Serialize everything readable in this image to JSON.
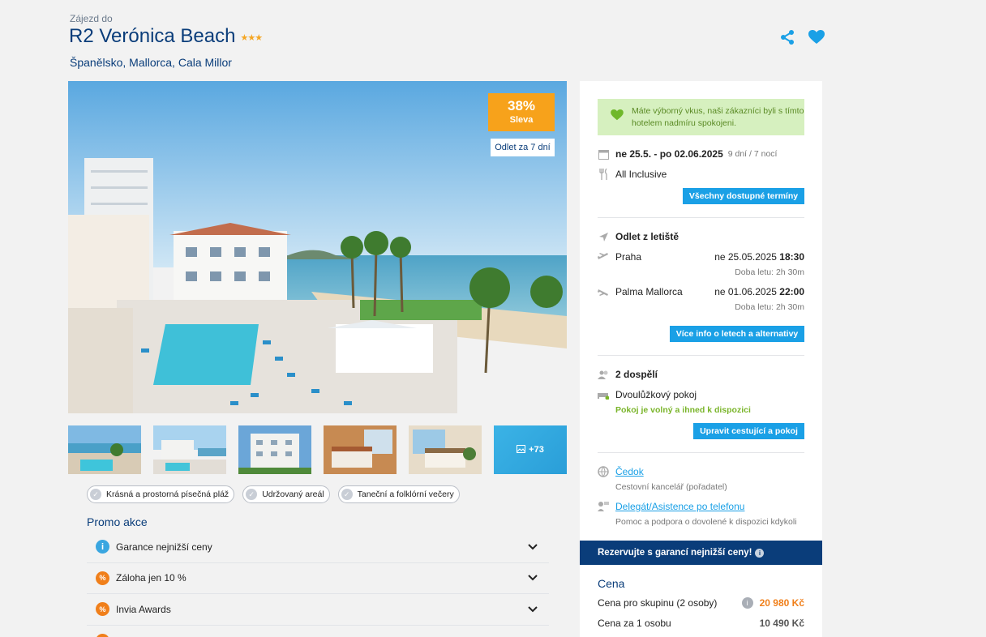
{
  "header": {
    "pre_title": "Zájezd do",
    "title": "R2 Verónica Beach",
    "stars": "★★★",
    "location": "Španělsko, Mallorca, Cala Millor"
  },
  "actions": {
    "share_icon": "share-icon",
    "favorite_icon": "heart-icon"
  },
  "photo": {
    "discount_pct": "38%",
    "discount_label": "Sleva",
    "depart_tag": "Odlet za 7 dní"
  },
  "thumbs": {
    "more_label": "+73"
  },
  "tags": [
    "Krásná a prostorná písečná pláž",
    "Udržovaný areál",
    "Taneční a folklórní večery"
  ],
  "promo": {
    "title": "Promo akce",
    "items": [
      {
        "label": "Garance nejnižší ceny",
        "icon": "info-icon"
      },
      {
        "label": "Záloha jen 10 %",
        "icon": "percent-icon"
      },
      {
        "label": "Invia Awards",
        "icon": "percent-icon"
      }
    ]
  },
  "panel": {
    "alert": "Máte výborný vkus, naši zákazníci byli s tímto hotelem nadmíru spokojeni.",
    "dates": "ne 25.5. - po 02.06.2025",
    "duration": "9 dní / 7 nocí",
    "board": "All Inclusive",
    "all_dates_btn": "Všechny dostupné termíny",
    "departure_label": "Odlet z letiště",
    "outbound": {
      "from": "Praha",
      "date": "ne 25.05.2025",
      "time": "18:30",
      "duration": "Doba letu: 2h 30m"
    },
    "inbound": {
      "from": "Palma Mallorca",
      "date": "ne 01.06.2025",
      "time": "22:00",
      "duration": "Doba letu: 2h 30m"
    },
    "flights_btn": "Více info o letech a alternativy",
    "travelers": "2 dospělí",
    "room": "Dvoulůžkový pokoj",
    "room_status": "Pokoj je volný a ihned k dispozici",
    "edit_btn": "Upravit cestující a pokoj",
    "agency_link": "Čedok",
    "agency_sub": "Cestovní kancelář (pořadatel)",
    "delegate_link": "Delegát/Asistence po telefonu",
    "delegate_sub": "Pomoc a podpora o dovolené k dispozici kdykoli",
    "banner": "Rezervujte s garancí nejnižší ceny!",
    "price_title": "Cena",
    "price_group_label": "Cena pro skupinu (2 osoby)",
    "price_group_value": "20 980 Kč",
    "price_person_label": "Cena za 1 osobu",
    "price_person_value": "10 490 Kč"
  },
  "colors": {
    "brand": "#0a3d7a",
    "accent": "#1aa0e6",
    "orange": "#f07f1a",
    "discount": "#f7a21b",
    "green": "#7ab52a"
  }
}
